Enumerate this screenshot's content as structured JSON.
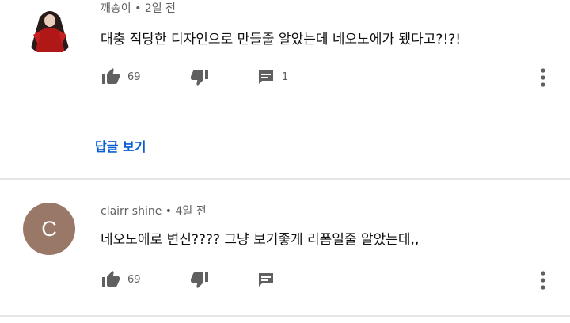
{
  "comments": [
    {
      "author": "깨송이",
      "time": "2일 전",
      "text": "대충 적당한 디자인으로 만들줄 알았는데 네오노에가 됐다고?!?!",
      "likes": "69",
      "reply_count": "1",
      "view_replies_label": "답글 보기",
      "avatar_color": "#b01818"
    },
    {
      "author": "clairr shine",
      "time": "4일 전",
      "text": "네오노에로 변신???? 그냥 보기좋게 리폼일줄 알았는데,,",
      "likes": "69",
      "avatar_letter": "C",
      "avatar_color": "#9a7868"
    }
  ],
  "meta_separator": "•",
  "colors": {
    "link": "#065fd4",
    "icon": "#606060",
    "divider": "#e6e6e6"
  }
}
